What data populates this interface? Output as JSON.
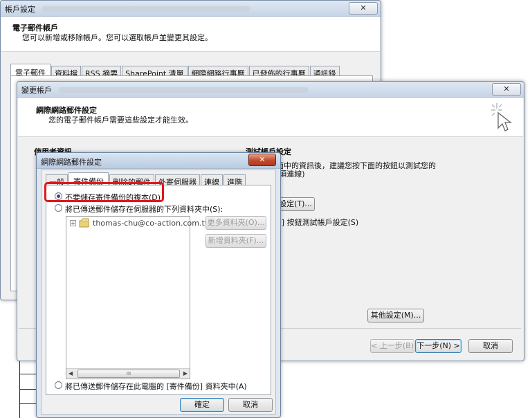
{
  "account_window": {
    "title": "帳戶設定",
    "close": "✕",
    "header_title": "電子郵件帳戶",
    "header_desc": "您可以新增或移除帳戶。您可以選取帳戶並變更其設定。",
    "tabs": [
      "電子郵件",
      "資料檔",
      "RSS 摘要",
      "SharePoint 清單",
      "網際網路行事曆",
      "已發佈的行事曆",
      "通訊錄"
    ]
  },
  "change_window": {
    "title": "變更帳戶",
    "close": "✕",
    "header_title": "網際網路郵件設定",
    "header_desc": "您的電子郵件帳戶需要這些設定才能生效。",
    "user_info": "使用者資訊",
    "test_title": "測試帳戶設定",
    "test_desc_1": "輸入此畫面中的資訊後，建議您按下面的按鈕以測試您的",
    "test_desc_2": "帳戶。(必須連線)",
    "test_button": "測試帳戶設定(T)...",
    "next_desc": "按 [下一步] 按鈕測試帳戶設定(S)",
    "more_settings": "其他設定(M)...",
    "back": "< 上一步(B)",
    "next": "下一步(N) >",
    "cancel": "取消"
  },
  "inner_dialog": {
    "title": "網際網路郵件設定",
    "close": "✕",
    "tabs": [
      "一般",
      "寄件備份",
      "刪除的郵件",
      "外寄伺服器",
      "連線",
      "進階"
    ],
    "active_tab": "寄件備份",
    "option_no_copy": "不要儲存寄件備份的複本(D)",
    "option_server": "將已傳送郵件儲存在伺服器的下列資料夾中(S):",
    "tree_item": "thomas-chu@co-action.com.tw I",
    "more_folders": "更多資料夾(O)...",
    "new_folder": "新增資料夾(F)...",
    "scroll_mark": "III",
    "option_local": "將已傳送郵件儲存在此電腦的 [寄件備份] 資料夾中(A)",
    "ok": "確定",
    "cancel": "取消"
  },
  "colors": {
    "highlight": "#e2171c",
    "radio_selected": "#1d4f9c"
  }
}
